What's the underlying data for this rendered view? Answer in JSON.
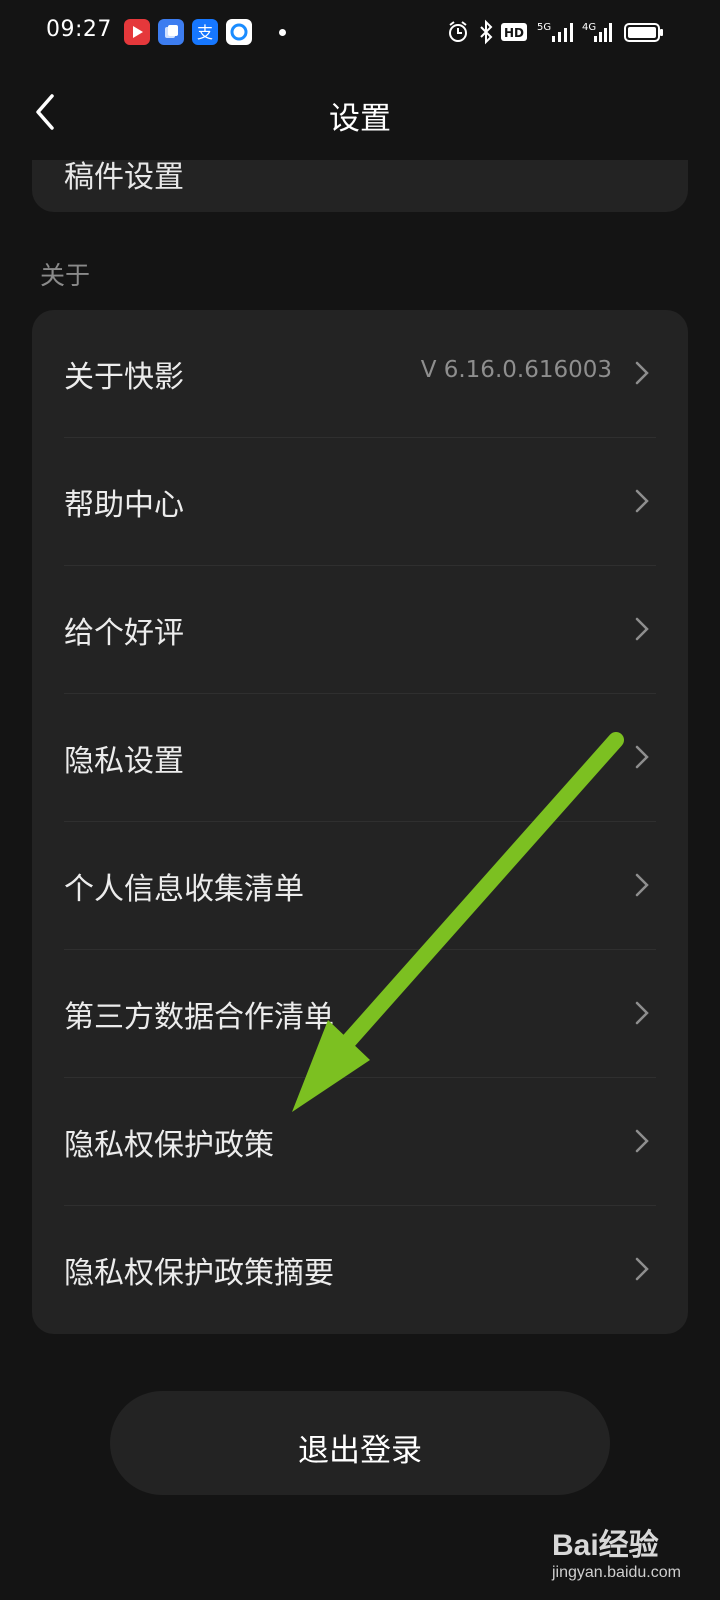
{
  "status_bar": {
    "time": "09:27",
    "apps": [
      "kuaiying-app-icon",
      "files-app-icon",
      "alipay-app-icon",
      "circle-app-icon"
    ],
    "right_icons": [
      "alarm-icon",
      "bluetooth-icon",
      "hd-icon",
      "signal-5g-icon",
      "signal-4g-icon",
      "battery-icon"
    ],
    "hd": "HD",
    "net1": "5G",
    "net2": "4G"
  },
  "nav": {
    "title": "设置"
  },
  "top_card": {
    "label": "稿件设置"
  },
  "section": {
    "label": "关于"
  },
  "items": [
    {
      "label": "关于快影",
      "value": "V 6.16.0.616003"
    },
    {
      "label": "帮助中心"
    },
    {
      "label": "给个好评"
    },
    {
      "label": "隐私设置"
    },
    {
      "label": "个人信息收集清单"
    },
    {
      "label": "第三方数据合作清单"
    },
    {
      "label": "隐私权保护政策"
    },
    {
      "label": "隐私权保护政策摘要"
    }
  ],
  "logout": {
    "label": "退出登录"
  },
  "watermark": {
    "main": "Bai经验",
    "sub": "jingyan.baidu.com"
  },
  "colors": {
    "background": "#141414",
    "card": "#232323",
    "arrow": "#7cc021"
  }
}
